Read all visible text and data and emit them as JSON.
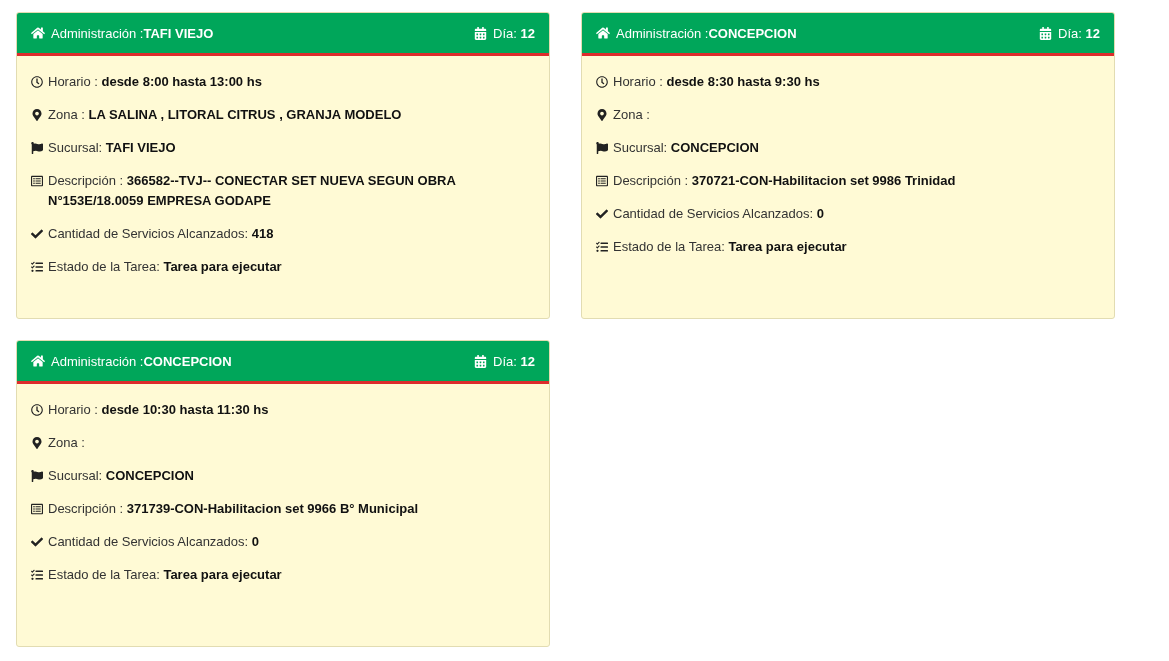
{
  "cards": [
    {
      "title": "Administración :**TAFI VIEJO**",
      "day": "Día: **12**",
      "rows": [
        {
          "kind": "clock",
          "text": "Horario : **desde 8:00 hasta 13:00 hs**"
        },
        {
          "kind": "pin",
          "text": "Zona : **LA SALINA , LITORAL CITRUS , GRANJA MODELO**"
        },
        {
          "kind": "flag",
          "text": "Sucursal: **TAFI VIEJO**"
        },
        {
          "kind": "list",
          "text": "Descripción : **366582--TVJ-- CONECTAR SET NUEVA SEGUN OBRA N°153E/18.0059 EMPRESA GODAPE**"
        },
        {
          "kind": "check",
          "text": "Cantidad de Servicios Alcanzados: **418**"
        },
        {
          "kind": "tasks",
          "text": "Estado de la Tarea: **Tarea para ejecutar**"
        }
      ]
    },
    {
      "title": "Administración :**CONCEPCION**",
      "day": "Día: **12**",
      "rows": [
        {
          "kind": "clock",
          "text": "Horario : **desde 8:30 hasta 9:30 hs**"
        },
        {
          "kind": "pin",
          "text": "Zona :"
        },
        {
          "kind": "flag",
          "text": "Sucursal: **CONCEPCION**"
        },
        {
          "kind": "list",
          "text": "Descripción : **370721-CON-Habilitacion set 9986 Trinidad**"
        },
        {
          "kind": "check",
          "text": "Cantidad de Servicios Alcanzados: **0**"
        },
        {
          "kind": "tasks",
          "text": "Estado de la Tarea: **Tarea para ejecutar**"
        }
      ]
    },
    {
      "title": "Administración :**CONCEPCION**",
      "day": "Día: **12**",
      "rows": [
        {
          "kind": "clock",
          "text": "Horario : **desde 10:30 hasta 11:30 hs**"
        },
        {
          "kind": "pin",
          "text": "Zona :"
        },
        {
          "kind": "flag",
          "text": "Sucursal: **CONCEPCION**"
        },
        {
          "kind": "list",
          "text": "Descripción : **371739-CON-Habilitacion set 9966 B° Municipal**"
        },
        {
          "kind": "check",
          "text": "Cantidad de Servicios Alcanzados: **0**"
        },
        {
          "kind": "tasks",
          "text": "Estado de la Tarea: **Tarea para ejecutar**"
        }
      ]
    }
  ]
}
